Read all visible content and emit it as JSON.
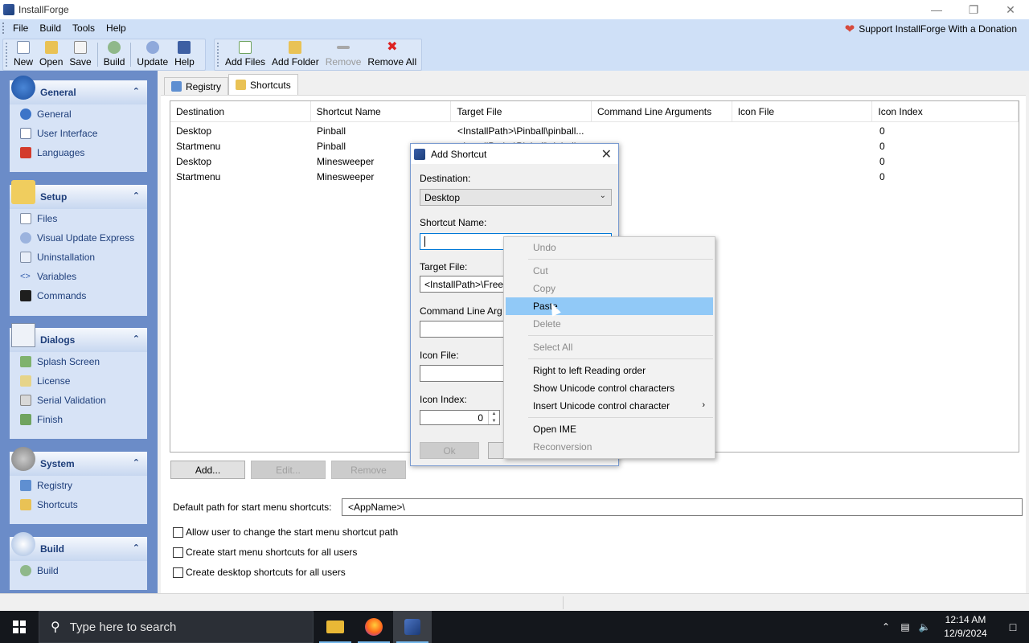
{
  "window": {
    "title": "InstallForge"
  },
  "menu": {
    "items": [
      "File",
      "Build",
      "Tools",
      "Help"
    ],
    "donate": "Support InstallForge With a Donation"
  },
  "toolbar": {
    "new": "New",
    "open": "Open",
    "save": "Save",
    "build": "Build",
    "update": "Update",
    "help": "Help",
    "add_files": "Add Files",
    "add_folder": "Add Folder",
    "remove": "Remove",
    "remove_all": "Remove All"
  },
  "sidebar": {
    "general": {
      "title": "General",
      "items": [
        "General",
        "User Interface",
        "Languages"
      ]
    },
    "setup": {
      "title": "Setup",
      "items": [
        "Files",
        "Visual Update Express",
        "Uninstallation",
        "Variables",
        "Commands"
      ]
    },
    "dialogs": {
      "title": "Dialogs",
      "items": [
        "Splash Screen",
        "License",
        "Serial Validation",
        "Finish"
      ]
    },
    "system": {
      "title": "System",
      "items": [
        "Registry",
        "Shortcuts"
      ]
    },
    "build": {
      "title": "Build",
      "items": [
        "Build"
      ]
    }
  },
  "tabs": [
    "Registry",
    "Shortcuts"
  ],
  "table": {
    "columns": [
      "Destination",
      "Shortcut Name",
      "Target File",
      "Command Line Arguments",
      "Icon File",
      "Icon Index"
    ],
    "rows": [
      [
        "Desktop",
        "Pinball",
        "<InstallPath>\\Pinball\\pinball...",
        "",
        "",
        "0"
      ],
      [
        "Startmenu",
        "Pinball",
        "<InstallPath>\\Pinball\\pinball...",
        "",
        "",
        "0"
      ],
      [
        "Desktop",
        "Minesweeper",
        "",
        "",
        "",
        "0"
      ],
      [
        "Startmenu",
        "Minesweeper",
        "",
        "",
        "",
        "0"
      ]
    ]
  },
  "buttons": {
    "add": "Add...",
    "edit": "Edit...",
    "remove": "Remove"
  },
  "start_menu_path": {
    "label": "Default path for start menu shortcuts:",
    "value": "<AppName>\\"
  },
  "checkboxes": [
    "Allow user to change the start menu shortcut path",
    "Create start menu shortcuts for all users",
    "Create desktop shortcuts for all users"
  ],
  "dialog": {
    "title": "Add Shortcut",
    "destination_label": "Destination:",
    "destination_value": "Desktop",
    "shortcut_name_label": "Shortcut Name:",
    "target_file_label": "Target File:",
    "target_file_value": "<InstallPath>\\Free",
    "cmd_args_label": "Command Line Arg",
    "icon_file_label": "Icon File:",
    "icon_index_label": "Icon Index:",
    "icon_index_value": "0",
    "ok": "Ok"
  },
  "context_menu": {
    "undo": "Undo",
    "cut": "Cut",
    "copy": "Copy",
    "paste": "Paste",
    "delete": "Delete",
    "select_all": "Select All",
    "rtl": "Right to left Reading order",
    "show_unicode": "Show Unicode control characters",
    "insert_unicode": "Insert Unicode control character",
    "open_ime": "Open IME",
    "reconversion": "Reconversion"
  },
  "taskbar": {
    "search_placeholder": "Type here to search",
    "time": "12:14 AM",
    "date": "12/9/2024"
  }
}
